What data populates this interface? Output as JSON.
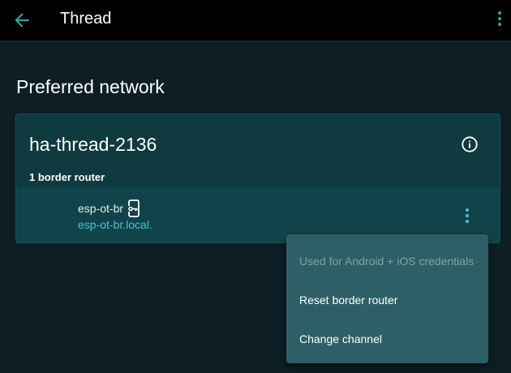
{
  "header": {
    "title": "Thread",
    "back_icon": "arrow-left-icon",
    "menu_icon": "dots-vertical-icon"
  },
  "main": {
    "section_title": "Preferred network",
    "network": {
      "name": "ha-thread-2136",
      "info_icon": "info-circle-icon",
      "border_router_count": "1 border router",
      "router": {
        "name": "esp-ot-br",
        "host": "esp-ot-br.local.",
        "badge_icon": "device-key-icon",
        "menu_icon": "dots-vertical-icon"
      }
    }
  },
  "context_menu": {
    "items": [
      {
        "label": "Used for Android + iOS credentials",
        "disabled": true
      },
      {
        "label": "Reset border router",
        "disabled": false
      },
      {
        "label": "Change channel",
        "disabled": false
      }
    ]
  },
  "colors": {
    "background": "#0d1f25",
    "topbar": "#000000",
    "card": "#0f3a40",
    "accent": "#45c5d3",
    "menu": "#2f5f66"
  }
}
